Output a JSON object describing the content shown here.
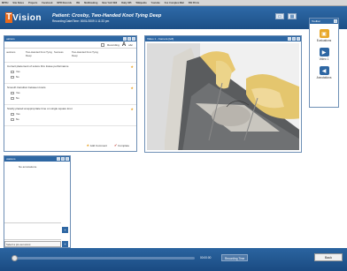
{
  "bookmarks": [
    "MPFH",
    "Site Notes",
    "Projects",
    "Facebook",
    "NPR Records",
    "ISS",
    "Multitasking",
    "New York Will",
    "Daily 365",
    "Wikipedia",
    "Youtube",
    "Fox Complex Mail",
    "SW Prints"
  ],
  "app": {
    "logo_t": "T",
    "logo_rest": "Vision",
    "title": "Patient: Crosby, Two-Handed Knot Tying Deep",
    "subtitle": "Recording Date/Time: 00/01/2009 1:11:33 pm"
  },
  "top_icons": [
    "monitor-icon",
    "layout-icon"
  ],
  "rubric_panel": {
    "title": "uations",
    "recording_label": "Recording",
    "tool_a": "A",
    "tool_b": "abc",
    "columns": [
      "uestions",
      "Two-Handed Knot Tying Deep",
      "Success",
      "Two-Handed Knot Tying Deep"
    ],
    "questions": [
      {
        "text": "Correct placement of suture thru tissue performance",
        "options": [
          "Yes",
          "No"
        ]
      },
      {
        "text": "Smooth transition between knots",
        "options": [
          "Yes",
          "No"
        ]
      },
      {
        "text": "Sturdy placed at appropriate time on single square knot",
        "options": [
          "Yes",
          "No"
        ]
      }
    ],
    "add_comment": "Add Comment",
    "complete": "Complete"
  },
  "video_panel": {
    "title": "Video 1 - Camera (left)"
  },
  "annotations_panel": {
    "title": "otations",
    "empty_text": "No annotations.",
    "select_placeholder": "Select a pre-set annot",
    "add_symbol": "+"
  },
  "toolbox": {
    "title": "Toolbar",
    "tools": [
      {
        "label": "Evaluations",
        "icon": "evaluations-icon",
        "color": "#e8a82a"
      },
      {
        "label": "Video 1",
        "icon": "video-icon",
        "color": "#2e67a3"
      },
      {
        "label": "Annotations",
        "icon": "annotations-icon",
        "color": "#2e67a3"
      }
    ]
  },
  "playback": {
    "timecode": "00:00:00",
    "recording_time": "Recording Time",
    "back": "Back"
  }
}
